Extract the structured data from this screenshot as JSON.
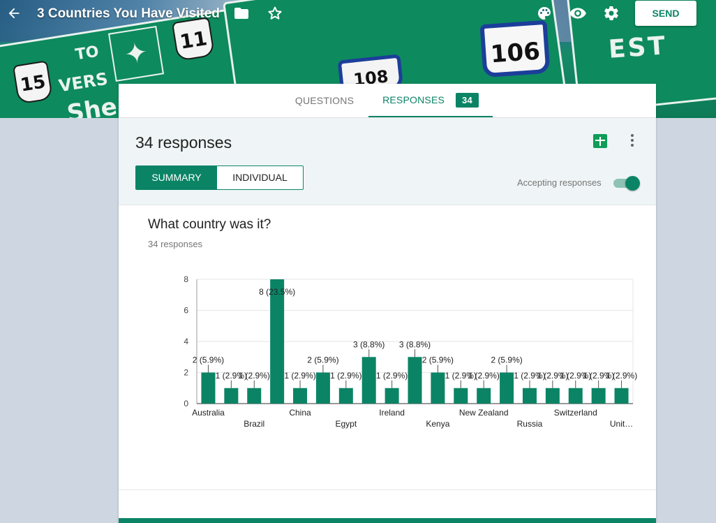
{
  "header": {
    "title": "3 Countries You Have Visited",
    "send_label": "SEND",
    "banner_signs": [
      "15",
      "TO",
      "VERS",
      "She",
      "11",
      "106",
      "EST",
      "108"
    ],
    "icons": [
      "back-arrow-icon",
      "folder-icon",
      "star-icon",
      "palette-icon",
      "eye-icon",
      "gear-icon"
    ]
  },
  "tabs": {
    "questions": "QUESTIONS",
    "responses": "RESPONSES",
    "responses_count": "34"
  },
  "summary": {
    "count_label": "34 responses",
    "summary_label": "SUMMARY",
    "individual_label": "INDIVIDUAL",
    "accepting_label": "Accepting responses",
    "accepting_on": true
  },
  "question": {
    "title": "What country was it?",
    "response_count": "34 responses"
  },
  "colors": {
    "accent": "#0b8466",
    "bar": "#0b8466",
    "background": "#cdd6e1"
  },
  "chart_data": {
    "type": "bar",
    "categories": [
      "Australia",
      "",
      "Brazil",
      "",
      "China",
      "",
      "Egypt",
      "",
      "Ireland",
      "",
      "Kenya",
      "",
      "New Zealand",
      "",
      "Russia",
      "",
      "Switzerland",
      "",
      "Unit…"
    ],
    "values": [
      2,
      1,
      1,
      8,
      1,
      2,
      1,
      3,
      1,
      3,
      2,
      1,
      1,
      2,
      1,
      1,
      1,
      1,
      1
    ],
    "data_labels": [
      "2 (5.9%)",
      "1 (2.9%)",
      "1 (2.9%)",
      "8 (23.5%)",
      "1 (2.9%)",
      "2 (5.9%)",
      "1 (2.9%)",
      "3 (8.8%)",
      "1 (2.9%)",
      "3 (8.8%)",
      "2 (5.9%)",
      "1 (2.9%)",
      "1 (2.9%)",
      "2 (5.9%)",
      "1 (2.9%)",
      "1 (2.9%)",
      "1 (2.9%)",
      "1 (2.9%)",
      "1 (2.9%)"
    ],
    "yticks": [
      "0",
      "2",
      "4",
      "6",
      "8"
    ],
    "ylim": [
      0,
      8
    ],
    "grid": true,
    "title": "",
    "xlabel": "",
    "ylabel": ""
  }
}
